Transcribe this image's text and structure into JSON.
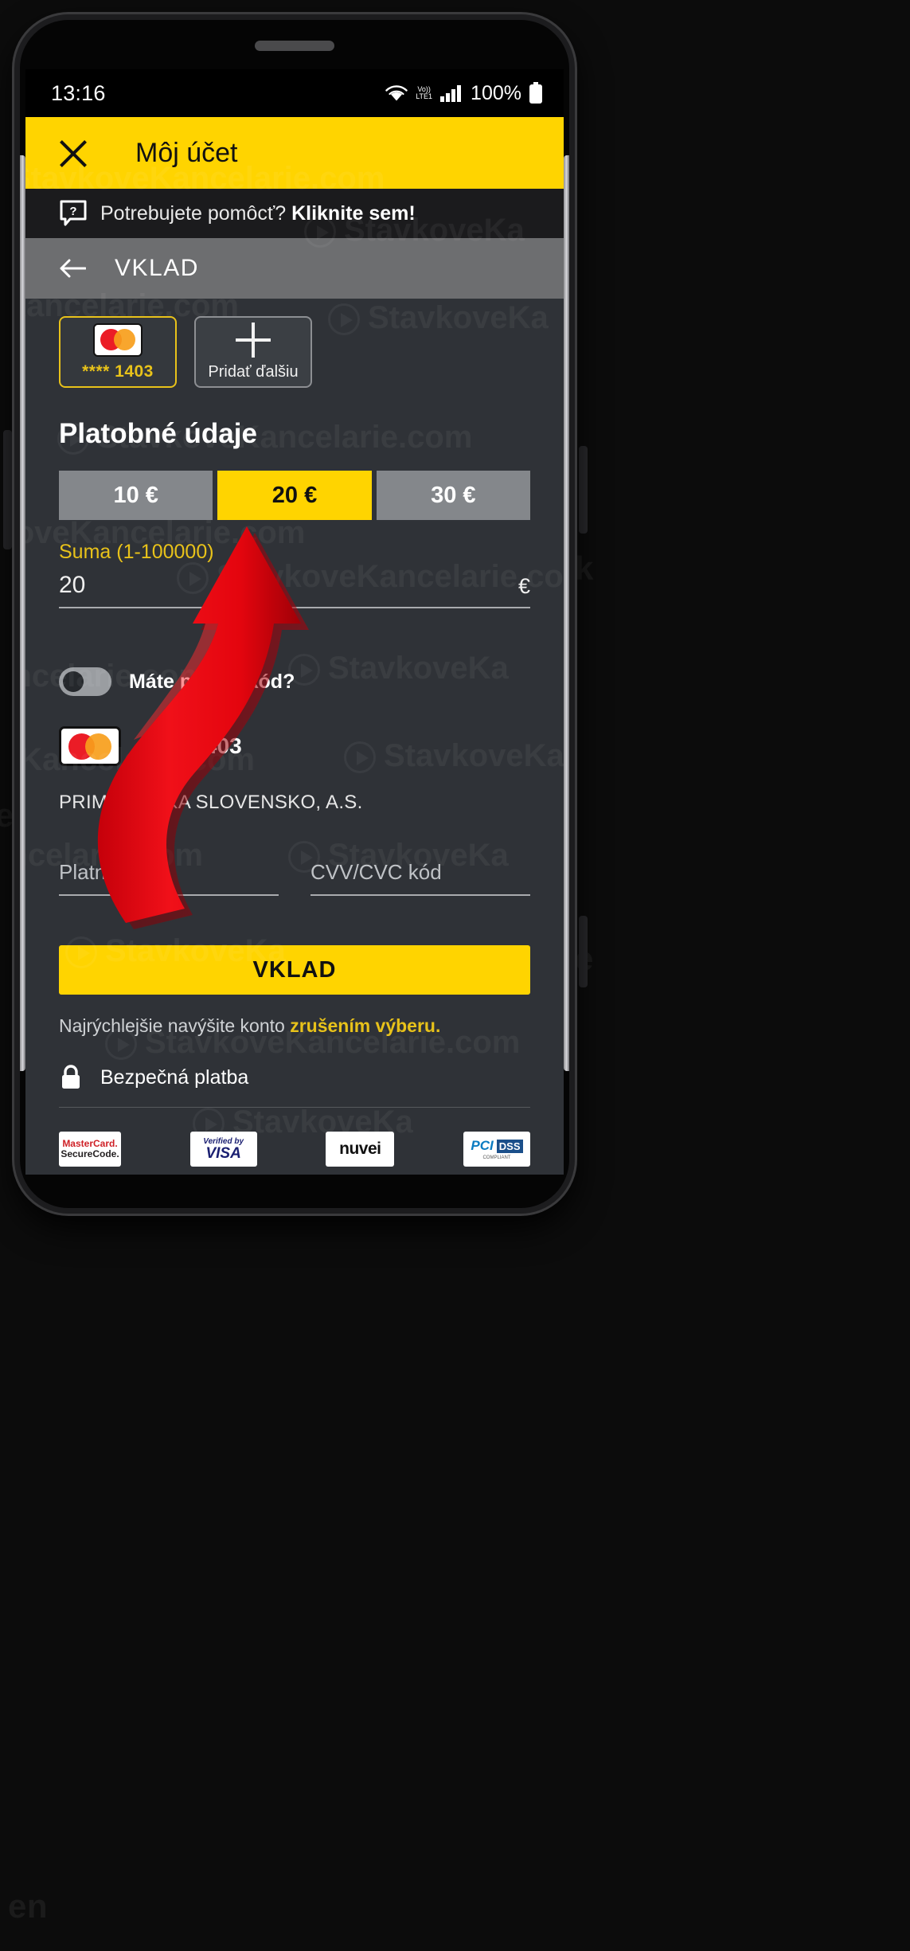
{
  "status_bar": {
    "time": "13:16",
    "battery_percent": "100%",
    "icons": [
      "wifi-icon",
      "volte-icon",
      "signal-icon",
      "battery-icon"
    ],
    "volte_line1": "Vo))",
    "volte_line2": "LTE1"
  },
  "app_bar": {
    "close_label": "close-icon",
    "title": "Môj účet"
  },
  "help_bar": {
    "icon": "help-bubble-icon",
    "text": "Potrebujete pomôcť? ",
    "link_text": "Kliknite sem!"
  },
  "sub_bar": {
    "back_icon": "back-arrow-icon",
    "title": "VKLAD"
  },
  "cards": {
    "saved": {
      "brand": "mastercard",
      "number": "**** 1403",
      "selected": true
    },
    "add_new": {
      "label": "Pridať ďalšiu",
      "icon": "plus-icon"
    }
  },
  "section": {
    "title": "Platobné údaje"
  },
  "quick_amounts": [
    {
      "label": "10 €",
      "active": false
    },
    {
      "label": "20 €",
      "active": true
    },
    {
      "label": "30 €",
      "active": false
    }
  ],
  "amount_field": {
    "label": "Suma (1-100000)",
    "value": "20",
    "currency": "€"
  },
  "bonus": {
    "label": "Máte promo kód?",
    "enabled": false
  },
  "saved_card": {
    "brand": "mastercard",
    "number": "**** 1403",
    "bank": "PRIMA BANKA SLOVENSKO, A.S."
  },
  "card_fields": [
    {
      "placeholder": "Platnosť do",
      "value": ""
    },
    {
      "placeholder": "CVV/CVC kód",
      "value": ""
    }
  ],
  "deposit_button": {
    "label": "VKLAD"
  },
  "fast_note": {
    "text": "Najrýchlejšie navýšite konto ",
    "link_text": "zrušením výberu."
  },
  "secure": {
    "icon": "lock-icon",
    "label": "Bezpečná platba"
  },
  "footer_logos": [
    {
      "name": "mastercard-securecode-logo",
      "line1": "MasterCard.",
      "line2": "SecureCode."
    },
    {
      "name": "verified-by-visa-logo",
      "line1": "Verified by",
      "line2": "VISA"
    },
    {
      "name": "nuvei-logo",
      "line1": "nuvei"
    },
    {
      "name": "pci-dss-logo",
      "line1": "PCI",
      "line2": "DSS",
      "line3": "COMPLIANT"
    }
  ],
  "watermarks": {
    "text": "StavkoveKancelarie.com",
    "short": "StavkoveKa",
    "short2": "eKancelarie.com",
    "short3": "rie.com"
  },
  "annotation": {
    "shape": "red-curved-arrow",
    "color": "#e8111b",
    "points_to": "add-new-card-tile"
  },
  "colors": {
    "brand_yellow": "#ffd400",
    "accent_yellow": "#e8c21a",
    "arrow_red": "#e8111b",
    "screen_bg": "#2f3237"
  }
}
